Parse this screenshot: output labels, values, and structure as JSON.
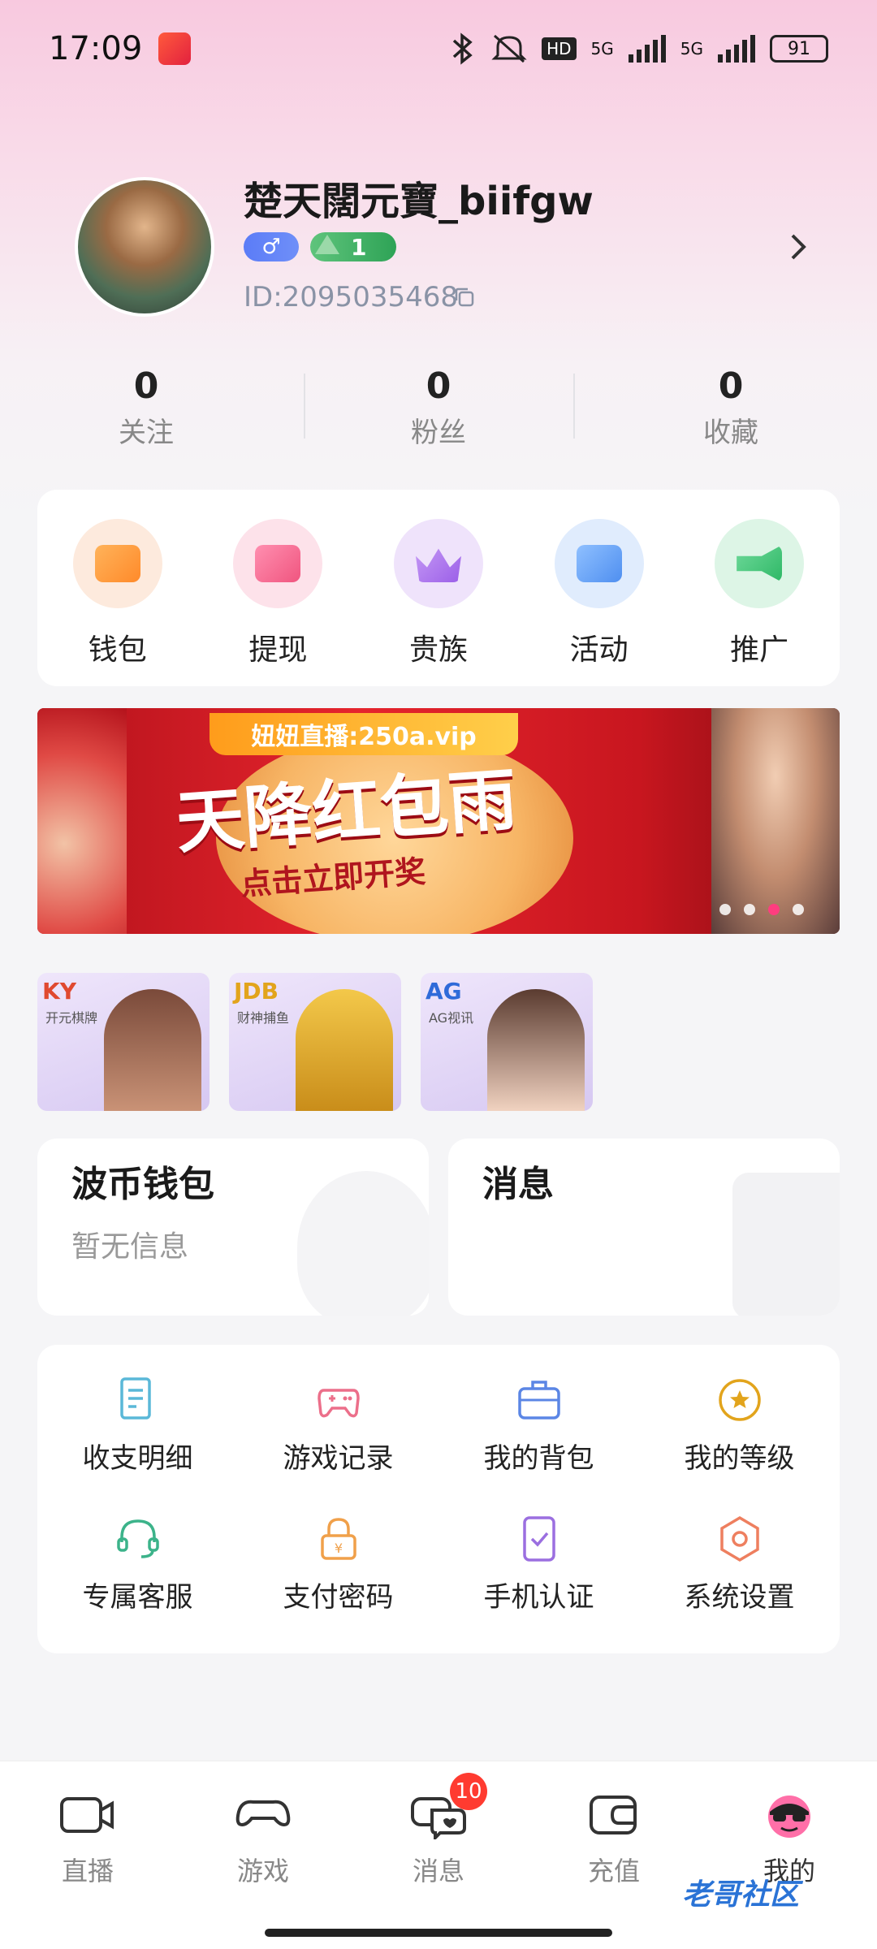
{
  "status_bar": {
    "time": "17:09",
    "network1": "5G",
    "network2": "5G",
    "hd": "HD",
    "battery": "91"
  },
  "profile": {
    "username": "楚天闊元寶_biifgw",
    "gender_symbol": "♂",
    "level": "1",
    "user_id": "ID:2095035468"
  },
  "stats": [
    {
      "value": "0",
      "label": "关注"
    },
    {
      "value": "0",
      "label": "粉丝"
    },
    {
      "value": "0",
      "label": "收藏"
    }
  ],
  "quick_actions": [
    {
      "label": "钱包",
      "icon": "wallet-icon"
    },
    {
      "label": "提现",
      "icon": "withdraw-icon"
    },
    {
      "label": "贵族",
      "icon": "crown-icon"
    },
    {
      "label": "活动",
      "icon": "gift-icon"
    },
    {
      "label": "推广",
      "icon": "megaphone-icon"
    }
  ],
  "banner": {
    "tag": "妞妞直播:250a.vip",
    "title": "天降红包雨",
    "subtitle": "点击立即开奖",
    "slide_count": 4,
    "active_slide": 3
  },
  "games": [
    {
      "logo": "KY",
      "caption": "开元棋牌",
      "color": "#e0492f"
    },
    {
      "logo": "JDB",
      "caption": "财神捕鱼",
      "color": "#e2a41c"
    },
    {
      "logo": "AG",
      "caption": "AG视讯",
      "color": "#2f6bd9"
    }
  ],
  "wallet_card": {
    "title": "波币钱包",
    "subtitle": "暂无信息"
  },
  "message_card": {
    "title": "消息"
  },
  "tools": [
    {
      "label": "收支明细",
      "icon": "document-icon"
    },
    {
      "label": "游戏记录",
      "icon": "gamepad-icon"
    },
    {
      "label": "我的背包",
      "icon": "bag-icon"
    },
    {
      "label": "我的等级",
      "icon": "star-icon"
    },
    {
      "label": "专属客服",
      "icon": "headset-icon"
    },
    {
      "label": "支付密码",
      "icon": "lock-icon"
    },
    {
      "label": "手机认证",
      "icon": "phone-check-icon"
    },
    {
      "label": "系统设置",
      "icon": "settings-icon"
    }
  ],
  "tabs": [
    {
      "label": "直播",
      "icon": "camera-icon"
    },
    {
      "label": "游戏",
      "icon": "controller-icon"
    },
    {
      "label": "消息",
      "icon": "chat-icon",
      "badge": "10"
    },
    {
      "label": "充值",
      "icon": "wallet-tab-icon"
    },
    {
      "label": "我的",
      "icon": "profile-icon",
      "active": true
    }
  ],
  "watermark": "老哥社区",
  "colors": {
    "accent_pink": "#ff3d7f",
    "gender_blue": "#5b7cf7",
    "level_green": "#2ea356",
    "badge_red": "#ff3b30"
  }
}
